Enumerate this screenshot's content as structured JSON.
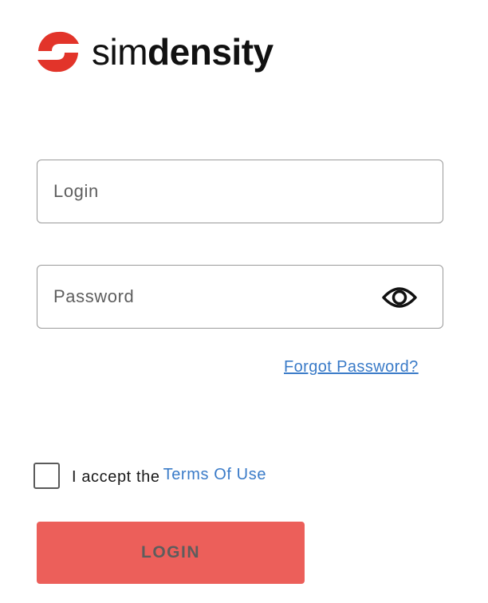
{
  "brand": {
    "name_light": "sim",
    "name_bold": "density",
    "color": "#e2342a"
  },
  "login_field": {
    "placeholder": "Login",
    "value": ""
  },
  "password_field": {
    "placeholder": "Password",
    "value": "",
    "toggle_icon": "eye-icon"
  },
  "forgot_password": {
    "label": "Forgot Password?"
  },
  "terms": {
    "checked": false,
    "prefix": "I accept the",
    "link_label": "Terms Of Use"
  },
  "login_button": {
    "label": "LOGIN",
    "background": "#ec5f5a",
    "text_color": "#5d5d5d"
  }
}
